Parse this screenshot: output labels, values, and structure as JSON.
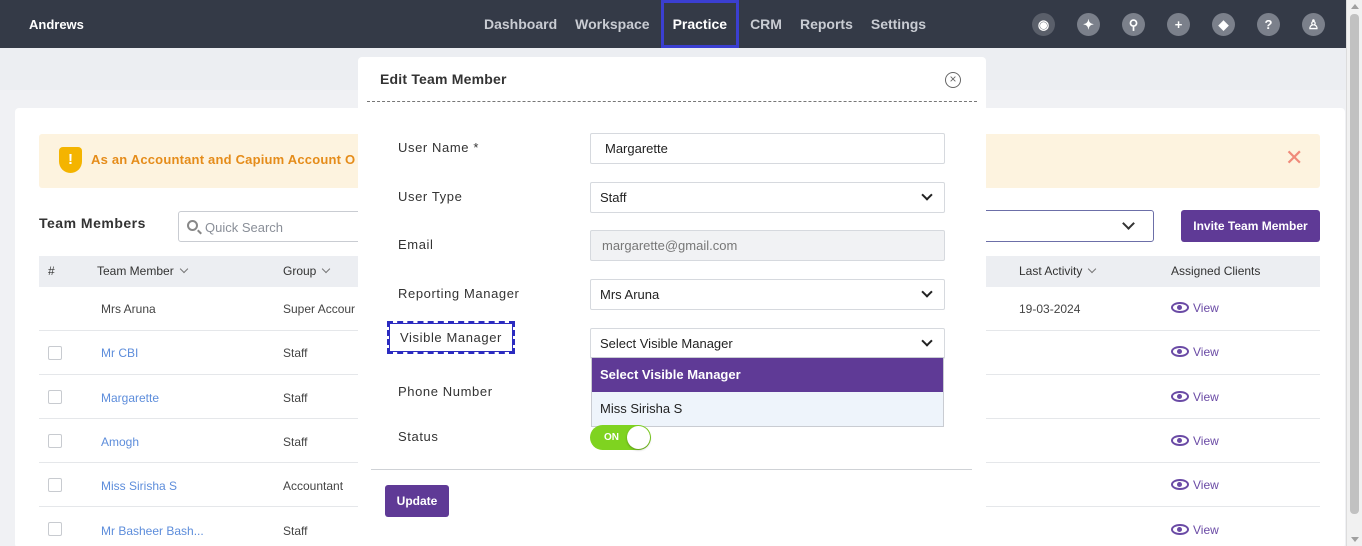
{
  "app": {
    "brand": "Andrews"
  },
  "nav": {
    "items": [
      "Dashboard",
      "Workspace",
      "Practice",
      "CRM",
      "Reports",
      "Settings"
    ],
    "active": "Practice"
  },
  "top_icons": [
    "user-circle-icon",
    "megaphone-icon",
    "search-icon",
    "plus-icon",
    "ticket-icon",
    "help-icon",
    "profile-icon"
  ],
  "alert": {
    "text": "As an Accountant and Capium Account O",
    "close": "✕"
  },
  "team": {
    "title": "Team Members",
    "search_placeholder": "Quick Search",
    "invite_label": "Invite Team Member",
    "columns": {
      "num": "#",
      "member": "Team Member",
      "group": "Group",
      "last_activity": "Last Activity",
      "assigned": "Assigned Clients"
    },
    "rows": [
      {
        "name": "Mrs Aruna",
        "group": "Super Accour",
        "last_activity": "19-03-2024",
        "view": "View",
        "link": false
      },
      {
        "name": "Mr CBI",
        "group": "Staff",
        "last_activity": "",
        "view": "View",
        "link": true
      },
      {
        "name": "Margarette",
        "group": "Staff",
        "last_activity": "",
        "view": "View",
        "link": true
      },
      {
        "name": "Amogh",
        "group": "Staff",
        "last_activity": "",
        "view": "View",
        "link": true
      },
      {
        "name": "Miss Sirisha S",
        "group": "Accountant",
        "last_activity": "",
        "view": "View",
        "link": true
      },
      {
        "name": "Mr Basheer Bash...",
        "group": "Staff",
        "last_activity": "",
        "view": "View",
        "link": true
      }
    ]
  },
  "modal": {
    "title": "Edit Team Member",
    "close": "×",
    "fields": {
      "user_name": {
        "label": "User Name *",
        "value": "Margarette"
      },
      "user_type": {
        "label": "User Type",
        "value": "Staff"
      },
      "email": {
        "label": "Email",
        "value": "margarette@gmail.com"
      },
      "reporting_manager": {
        "label": "Reporting Manager",
        "value": "Mrs Aruna"
      },
      "visible_manager": {
        "label": "Visible Manager",
        "value": "Select Visible Manager"
      },
      "phone": {
        "label": "Phone Number"
      },
      "status": {
        "label": "Status",
        "toggle": "ON"
      }
    },
    "dropdown_options": [
      "Select Visible Manager",
      "Miss Sirisha S"
    ],
    "update_label": "Update"
  },
  "colors": {
    "accent": "#5f3a96",
    "topbar": "#343a47",
    "toggle_on": "#7fd320",
    "link": "#5d8ddb"
  }
}
